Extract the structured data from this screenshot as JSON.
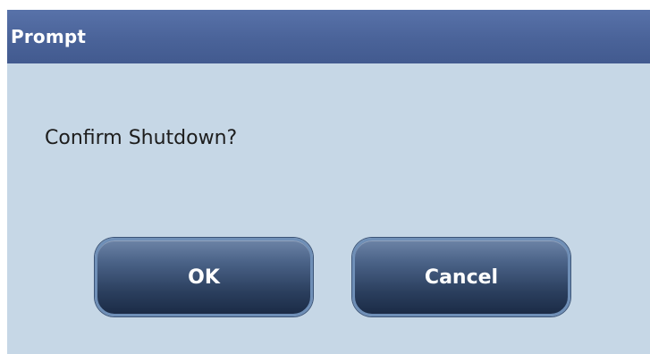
{
  "dialog": {
    "title": "Prompt",
    "message": "Confirm Shutdown?",
    "buttons": {
      "ok_label": "OK",
      "cancel_label": "Cancel"
    }
  },
  "colors": {
    "title_bar": "#4a6399",
    "dialog_background": "#c6d7e6",
    "button_dark": "#2b3f5e",
    "button_border": "#6f8fb7",
    "text_light": "#ffffff",
    "text_dark": "#1d1d1d"
  }
}
